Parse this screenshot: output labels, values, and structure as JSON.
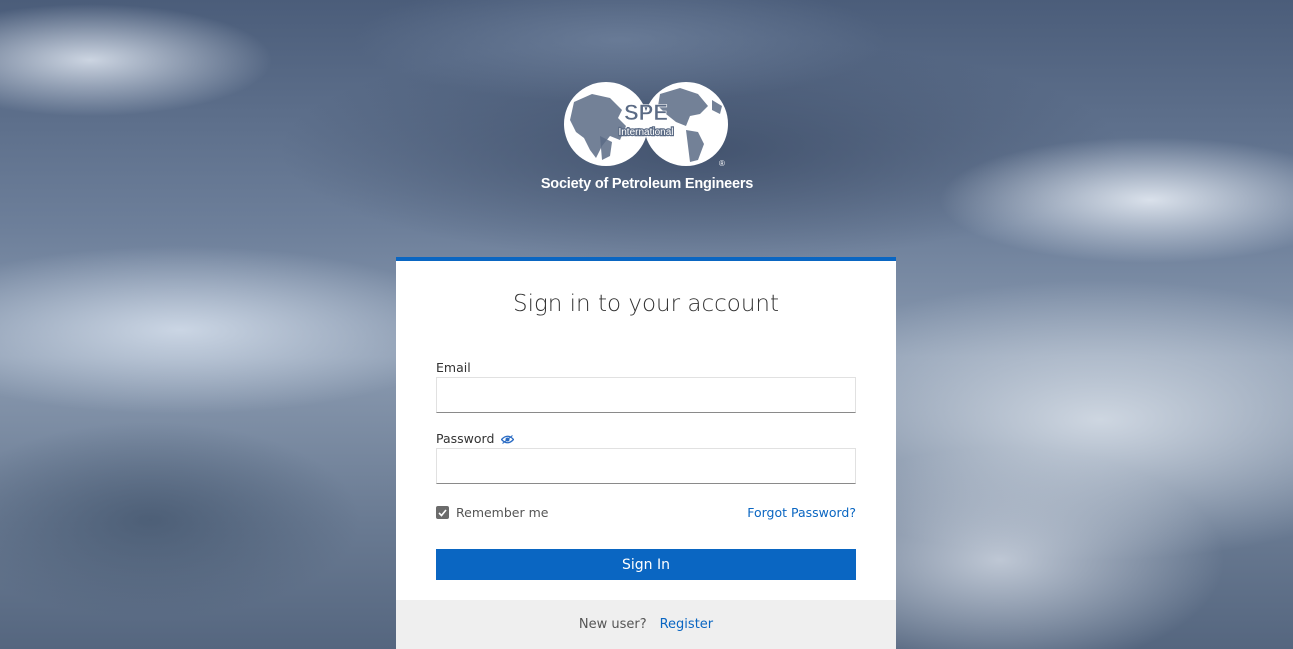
{
  "logo": {
    "mark_text": "SPE",
    "mark_subtext": "International",
    "registered": "®",
    "org_name": "Society of Petroleum Engineers"
  },
  "login": {
    "title": "Sign in to your account",
    "email_label": "Email",
    "email_value": "",
    "password_label": "Password",
    "password_value": "",
    "remember_label": "Remember me",
    "remember_checked": true,
    "forgot_label": "Forgot Password?",
    "signin_label": "Sign In",
    "new_user_label": "New user?",
    "register_label": "Register"
  },
  "colors": {
    "accent": "#0a66c2",
    "footer_bg": "#efefef"
  },
  "icons": {
    "password_toggle": "eye-icon",
    "checkbox": "check-icon"
  }
}
